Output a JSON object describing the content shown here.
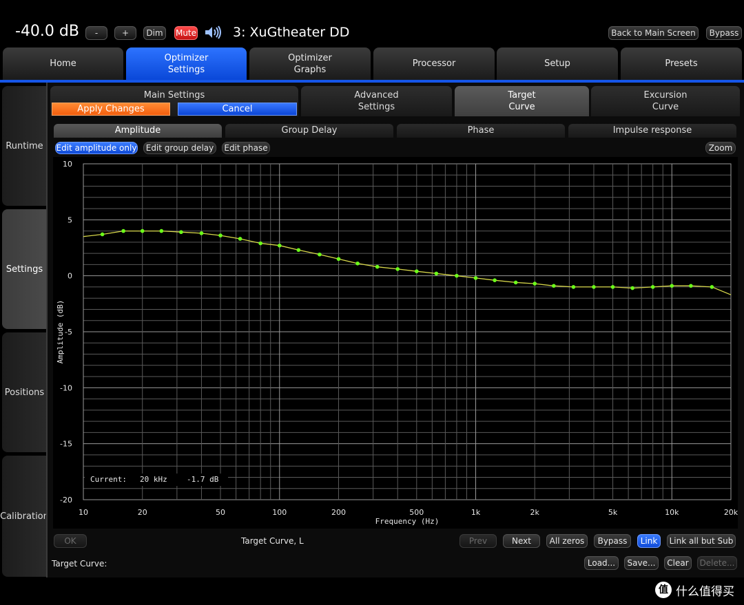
{
  "header": {
    "volume": "-40.0 dB",
    "vol_down": "-",
    "vol_up": "+",
    "dim": "Dim",
    "mute": "Mute",
    "preset_title": "3: XuGtheater DD",
    "back_to_main": "Back to Main Screen",
    "bypass": "Bypass"
  },
  "main_tabs": [
    {
      "label": "Home"
    },
    {
      "label": "Optimizer\nSettings"
    },
    {
      "label": "Optimizer\nGraphs"
    },
    {
      "label": "Processor"
    },
    {
      "label": "Setup"
    },
    {
      "label": "Presets"
    }
  ],
  "side_tabs": [
    {
      "label": "Runtime"
    },
    {
      "label": "Settings"
    },
    {
      "label": "Positions"
    },
    {
      "label": "Calibration"
    }
  ],
  "sub_tabs": {
    "main_settings": "Main Settings",
    "apply_changes": "Apply Changes",
    "cancel": "Cancel",
    "advanced": "Advanced\nSettings",
    "target": "Target\nCurve",
    "excursion": "Excursion\nCurve"
  },
  "graph_tabs": [
    {
      "label": "Amplitude"
    },
    {
      "label": "Group Delay"
    },
    {
      "label": "Phase"
    },
    {
      "label": "Impulse response"
    }
  ],
  "edit_modes": {
    "amplitude": "Edit amplitude only",
    "group_delay": "Edit group delay",
    "phase": "Edit phase",
    "zoom": "Zoom"
  },
  "readout": {
    "label": "Current:",
    "freq": "20 kHz",
    "value": "-1.7 dB"
  },
  "chart_data": {
    "type": "line",
    "xlabel": "Frequency (Hz)",
    "ylabel": "Amplitude (dB)",
    "xscale": "log",
    "xlim": [
      10,
      20000
    ],
    "ylim": [
      -20,
      10
    ],
    "grid": true,
    "y_ticks": [
      10,
      5,
      0,
      -5,
      -10,
      -15,
      -20
    ],
    "x_ticks": [
      {
        "v": 10,
        "label": "10"
      },
      {
        "v": 20,
        "label": "20"
      },
      {
        "v": 50,
        "label": "50"
      },
      {
        "v": 100,
        "label": "100"
      },
      {
        "v": 200,
        "label": "200"
      },
      {
        "v": 500,
        "label": "500"
      },
      {
        "v": 1000,
        "label": "1k"
      },
      {
        "v": 2000,
        "label": "2k"
      },
      {
        "v": 5000,
        "label": "5k"
      },
      {
        "v": 10000,
        "label": "10k"
      },
      {
        "v": 20000,
        "label": "20k"
      }
    ],
    "line_color": "#d8d84a",
    "point_color": "#6cff1a",
    "line": [
      {
        "x": 10,
        "y": 3.5
      },
      {
        "x": 12.5,
        "y": 3.7
      },
      {
        "x": 16,
        "y": 4.0
      },
      {
        "x": 20,
        "y": 4.0
      },
      {
        "x": 25,
        "y": 4.0
      },
      {
        "x": 31.5,
        "y": 3.9
      },
      {
        "x": 40,
        "y": 3.8
      },
      {
        "x": 50,
        "y": 3.6
      },
      {
        "x": 63,
        "y": 3.3
      },
      {
        "x": 80,
        "y": 2.9
      },
      {
        "x": 100,
        "y": 2.7
      },
      {
        "x": 125,
        "y": 2.3
      },
      {
        "x": 160,
        "y": 1.9
      },
      {
        "x": 200,
        "y": 1.5
      },
      {
        "x": 250,
        "y": 1.1
      },
      {
        "x": 315,
        "y": 0.8
      },
      {
        "x": 400,
        "y": 0.6
      },
      {
        "x": 500,
        "y": 0.4
      },
      {
        "x": 630,
        "y": 0.2
      },
      {
        "x": 800,
        "y": 0.0
      },
      {
        "x": 1000,
        "y": -0.2
      },
      {
        "x": 1250,
        "y": -0.4
      },
      {
        "x": 1600,
        "y": -0.6
      },
      {
        "x": 2000,
        "y": -0.7
      },
      {
        "x": 2500,
        "y": -0.9
      },
      {
        "x": 3150,
        "y": -1.0
      },
      {
        "x": 4000,
        "y": -1.0
      },
      {
        "x": 5000,
        "y": -1.0
      },
      {
        "x": 6300,
        "y": -1.1
      },
      {
        "x": 8000,
        "y": -1.0
      },
      {
        "x": 10000,
        "y": -0.9
      },
      {
        "x": 12500,
        "y": -0.9
      },
      {
        "x": 16000,
        "y": -1.0
      },
      {
        "x": 20000,
        "y": -1.7
      }
    ],
    "points": [
      {
        "x": 12.5,
        "y": 3.7
      },
      {
        "x": 16,
        "y": 4.0
      },
      {
        "x": 20,
        "y": 4.0
      },
      {
        "x": 25,
        "y": 4.0
      },
      {
        "x": 31.5,
        "y": 3.9
      },
      {
        "x": 40,
        "y": 3.8
      },
      {
        "x": 50,
        "y": 3.6
      },
      {
        "x": 63,
        "y": 3.3
      },
      {
        "x": 80,
        "y": 2.9
      },
      {
        "x": 100,
        "y": 2.7
      },
      {
        "x": 125,
        "y": 2.3
      },
      {
        "x": 160,
        "y": 1.9
      },
      {
        "x": 200,
        "y": 1.5
      },
      {
        "x": 250,
        "y": 1.1
      },
      {
        "x": 315,
        "y": 0.8
      },
      {
        "x": 400,
        "y": 0.6
      },
      {
        "x": 500,
        "y": 0.4
      },
      {
        "x": 630,
        "y": 0.2
      },
      {
        "x": 800,
        "y": 0.0
      },
      {
        "x": 1000,
        "y": -0.2
      },
      {
        "x": 1250,
        "y": -0.4
      },
      {
        "x": 1600,
        "y": -0.6
      },
      {
        "x": 2000,
        "y": -0.7
      },
      {
        "x": 2500,
        "y": -0.9
      },
      {
        "x": 3150,
        "y": -1.0
      },
      {
        "x": 4000,
        "y": -1.0
      },
      {
        "x": 5000,
        "y": -1.0
      },
      {
        "x": 6300,
        "y": -1.1
      },
      {
        "x": 8000,
        "y": -1.0
      },
      {
        "x": 10000,
        "y": -0.9
      },
      {
        "x": 12500,
        "y": -0.9
      },
      {
        "x": 16000,
        "y": -1.0
      }
    ]
  },
  "bottom": {
    "ok": "OK",
    "curve_name": "Target Curve, L",
    "prev": "Prev",
    "next": "Next",
    "all_zeros": "All zeros",
    "bypass": "Bypass",
    "link": "Link",
    "link_all_but_sub": "Link all but Sub",
    "target_curve_label": "Target Curve:",
    "load": "Load...",
    "save": "Save...",
    "clear": "Clear",
    "delete": "Delete..."
  },
  "watermark": {
    "logo": "值",
    "text": "什么值得买"
  }
}
